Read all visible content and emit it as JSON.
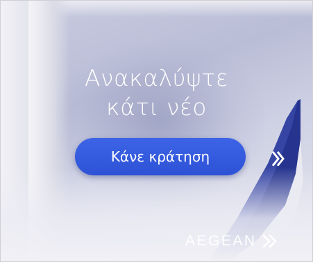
{
  "ad": {
    "headline_line1": "Ανακαλύψτε",
    "headline_line2": "κάτι νέο",
    "cta_label": "Κάνε κράτηση",
    "brand_name": "AEGEAN",
    "brand_mark_icon": "aegean-chevron-icon",
    "colors": {
      "cta_background": "#2d52d6",
      "wing_blue": "#1f2f8c",
      "text": "#ffffff"
    }
  }
}
